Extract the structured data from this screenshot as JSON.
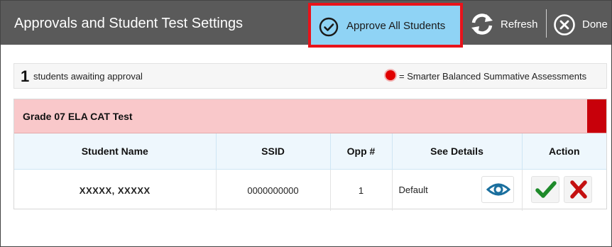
{
  "header": {
    "title": "Approvals and Student Test Settings",
    "approve_all_label": "Approve All Students",
    "refresh_label": "Refresh",
    "done_label": "Done"
  },
  "summary": {
    "count": "1",
    "count_text": "students awaiting approval",
    "legend_text": "= Smarter Balanced Summative Assessments",
    "legend_color": "#e00000"
  },
  "test": {
    "title": "Grade 07 ELA CAT Test",
    "banner_color": "#f9c8ca",
    "flag_color": "#c8000a"
  },
  "table": {
    "columns": [
      "Student Name",
      "SSID",
      "Opp #",
      "See Details",
      "Action"
    ],
    "rows": [
      {
        "name": "XXXXX, XXXXX",
        "ssid": "0000000000",
        "opp": "1",
        "details": "Default"
      }
    ]
  },
  "icons": {
    "approve_all": "check-circle-icon",
    "refresh": "refresh-icon",
    "done": "close-circle-icon",
    "details": "eye-icon",
    "approve": "checkmark-icon",
    "deny": "x-icon"
  },
  "colors": {
    "header_bg": "#5a5a5a",
    "approve_all_bg": "#8fd3f5",
    "highlight_border": "#e8131b",
    "approve_green": "#1e8a2a",
    "deny_red": "#c41010",
    "eye_blue": "#1a6f9e"
  }
}
